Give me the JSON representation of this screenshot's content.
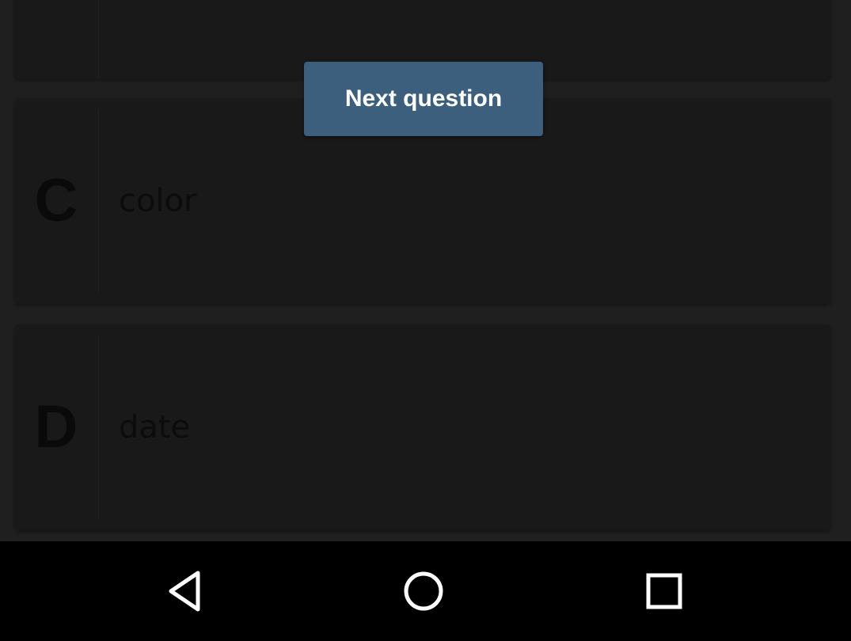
{
  "quiz": {
    "next_button_label": "Next question",
    "options": [
      {
        "letter": "C",
        "text": "color"
      },
      {
        "letter": "D",
        "text": "date"
      }
    ]
  },
  "navbar": {
    "icons": [
      "back-icon",
      "home-icon",
      "recents-icon"
    ],
    "icon_color": "#ffffff"
  },
  "colors": {
    "button_bg": "#3c5f7e",
    "background": "#1f1f1f",
    "card_bg": "#191919",
    "navbar_bg": "#000000"
  }
}
